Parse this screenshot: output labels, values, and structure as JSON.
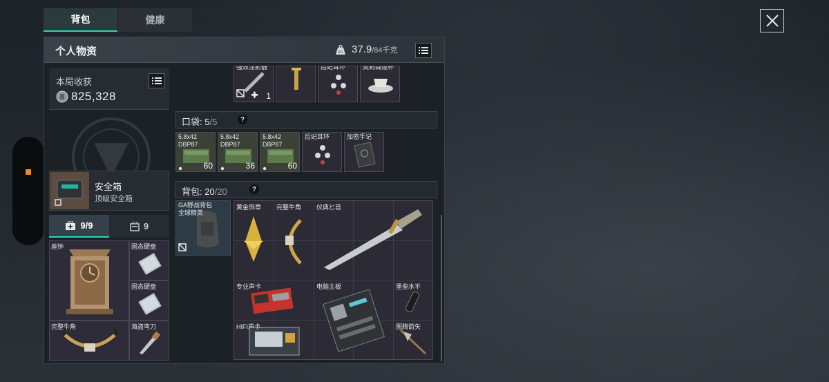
{
  "tabs": [
    {
      "label": "背包",
      "active": true
    },
    {
      "label": "健康",
      "active": false
    }
  ],
  "panel": {
    "title": "个人物资",
    "weight_icon_text": "KG",
    "weight_current": "37.9",
    "weight_max": "/84千克"
  },
  "earnings": {
    "title": "本局收获",
    "value": "825,328"
  },
  "safebox": {
    "name": "安全箱",
    "subtitle": "顶级安全箱"
  },
  "subtabs": [
    {
      "icon": "first-aid-kit-icon",
      "count": "9/9"
    },
    {
      "icon": "case-icon",
      "count": "9"
    }
  ],
  "left_grid": {
    "items": [
      {
        "name": "座钟"
      },
      {
        "name": "固态硬盘"
      },
      {
        "name": "固态硬盘"
      },
      {
        "name": "完整牛角"
      },
      {
        "name": "海盗弯刀"
      }
    ]
  },
  "top_row": {
    "items": [
      {
        "name": "强效注射器",
        "count": "1"
      },
      {
        "name": ""
      },
      {
        "name": "后妃耳环"
      },
      {
        "name": "奥莉薇娅杯"
      }
    ]
  },
  "pocket": {
    "label": "口袋:",
    "used": "5",
    "capacity": "/5",
    "help": "?",
    "items": [
      {
        "name": "5.8x42 DBP87",
        "count": "60"
      },
      {
        "name": "5.8x42 DBP87",
        "count": "36"
      },
      {
        "name": "5.8x42 DBP87",
        "count": "60"
      },
      {
        "name": "后妃耳环"
      },
      {
        "name": "加密手记"
      }
    ]
  },
  "backpack": {
    "label": "背包:",
    "used": "20",
    "capacity": "/20",
    "help": "?",
    "equipped": "GA野战背包 全球精英",
    "items": [
      {
        "name": "黄金饰章"
      },
      {
        "name": "完整牛角"
      },
      {
        "name": "仪典匕首"
      },
      {
        "name": "专业声卡"
      },
      {
        "name": "电脑主板"
      },
      {
        "name": "堡垒水平"
      },
      {
        "name": "HIFI声卡"
      },
      {
        "name": "图腾箭矢"
      }
    ]
  },
  "colors": {
    "accent": "#2fd4b4",
    "handle_dot": "#f08a16"
  }
}
